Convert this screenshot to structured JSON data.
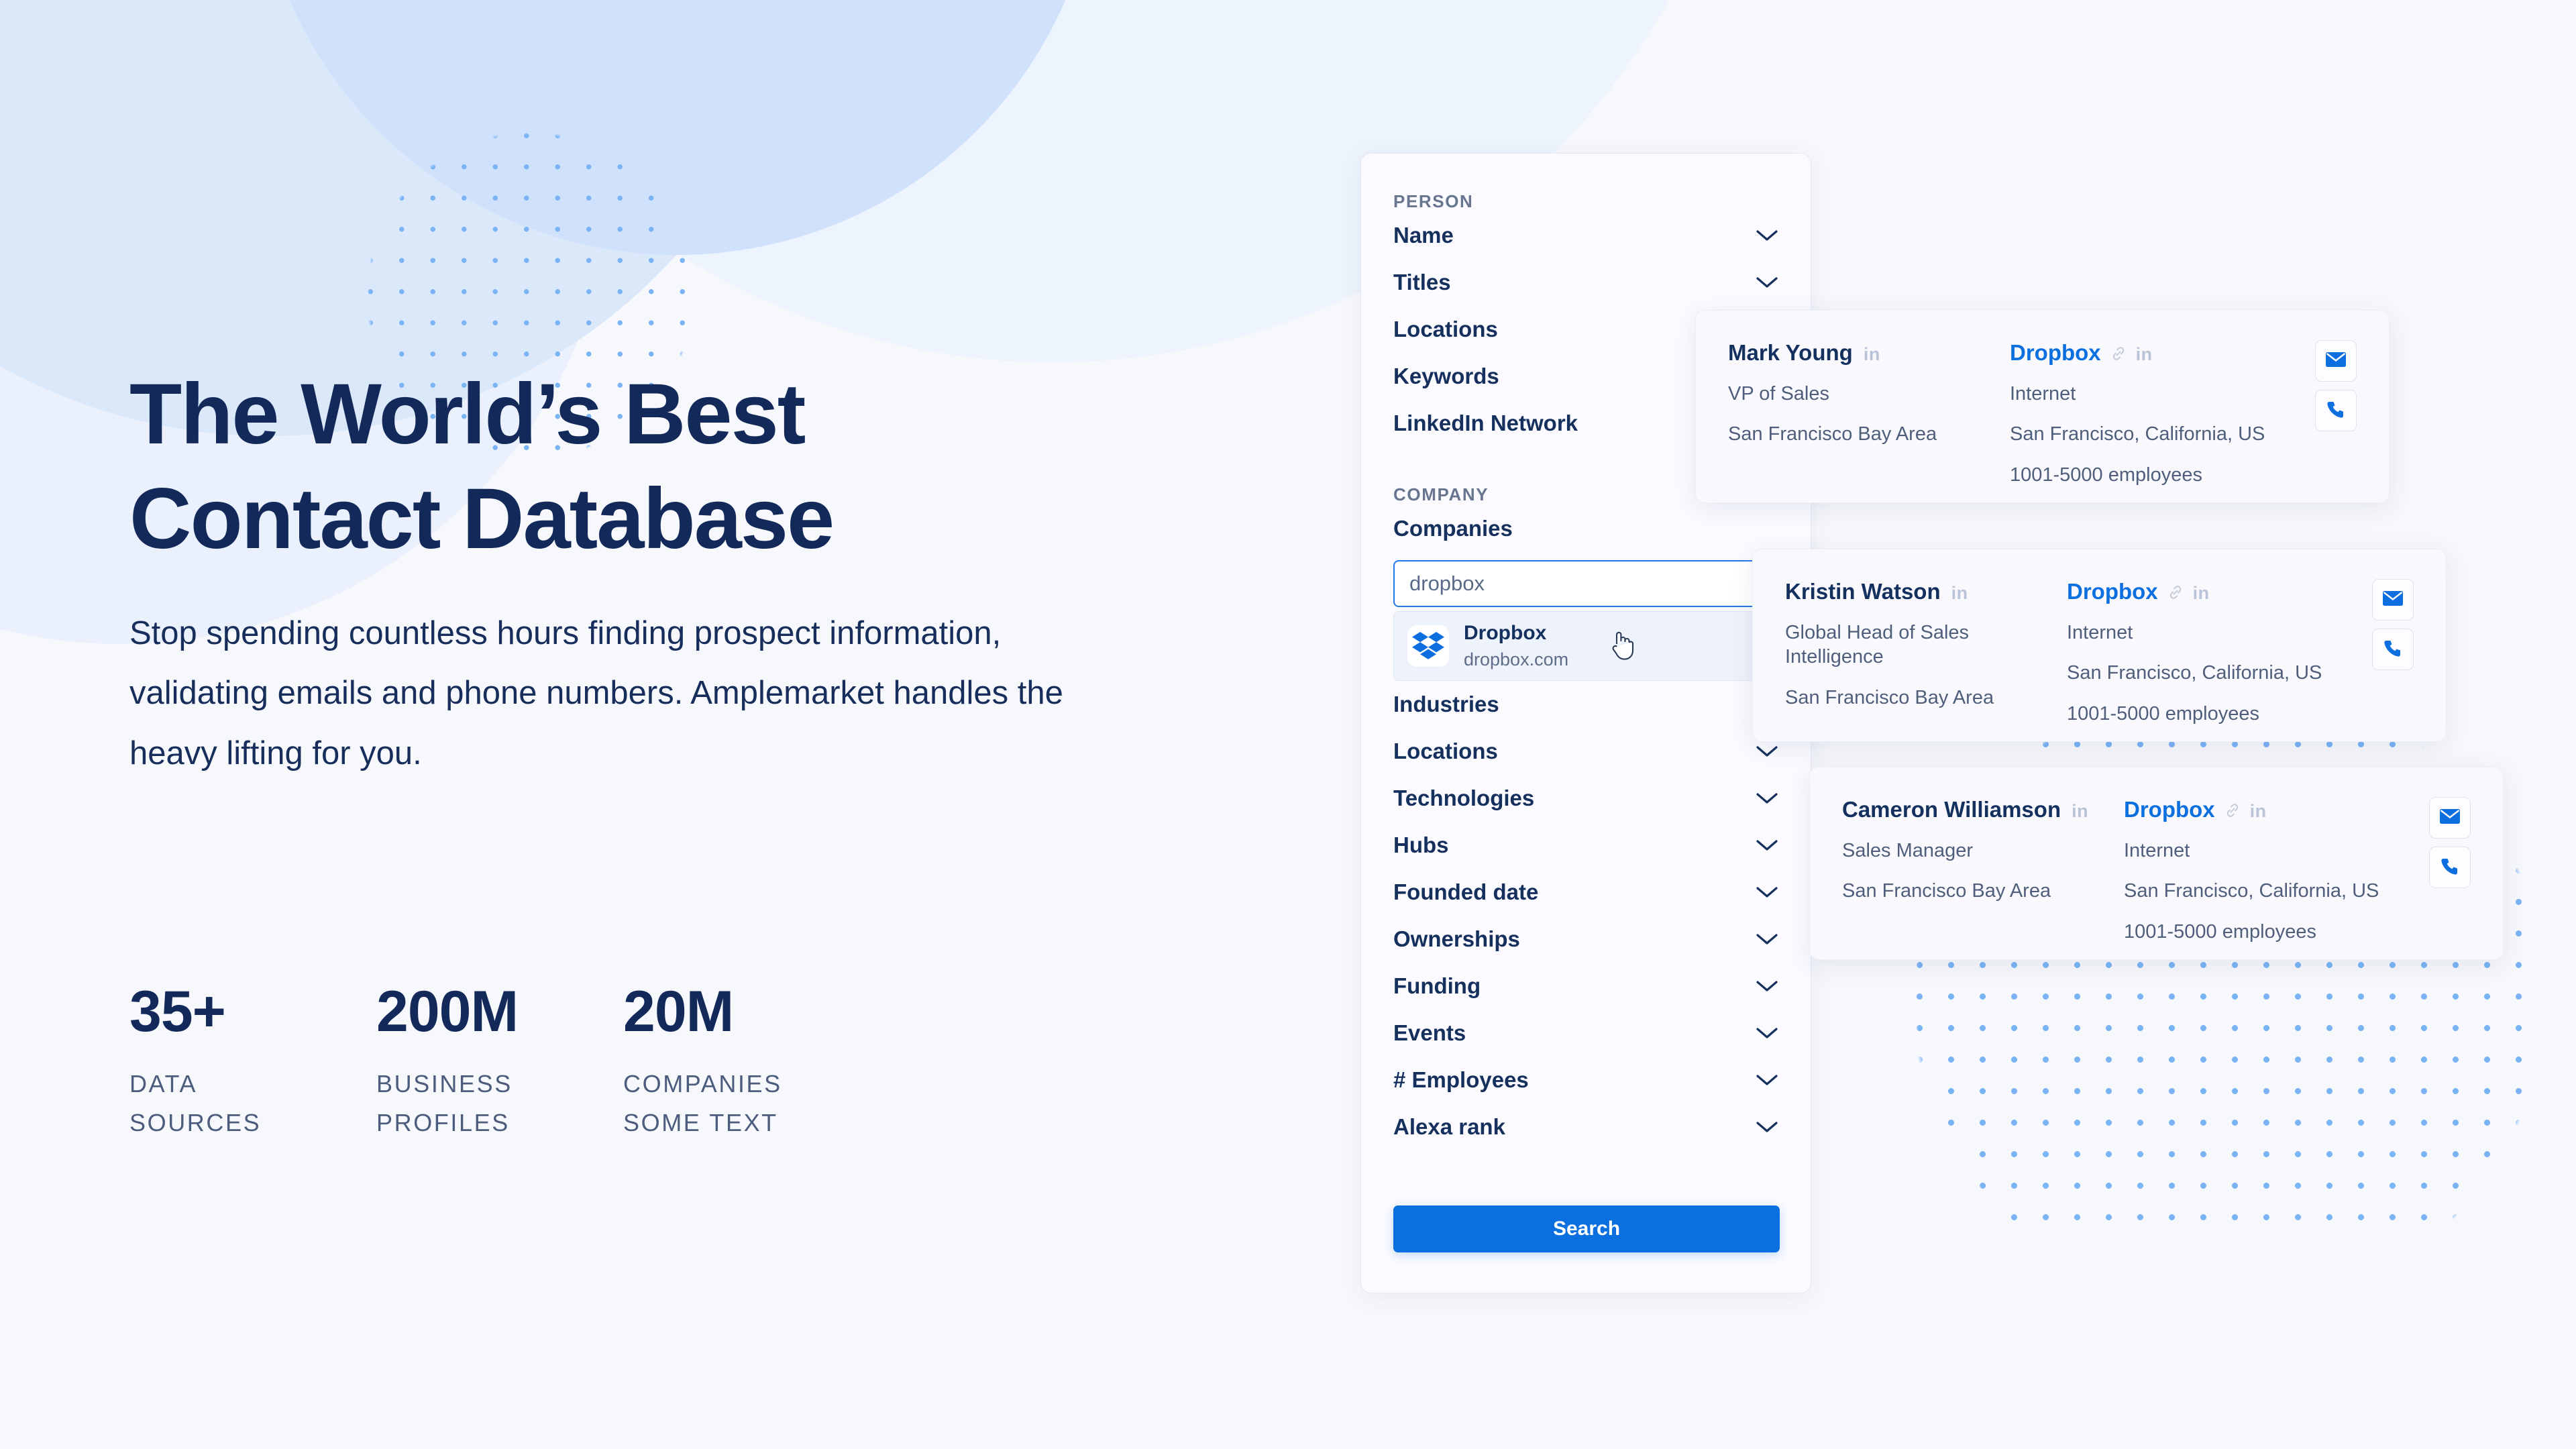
{
  "hero": {
    "heading_line1": "The World’s Best",
    "heading_line2": "Contact Database",
    "lead": "Stop spending countless hours finding prospect information, validating emails and phone numbers. Amplemarket handles the heavy lifting for you.",
    "stats": [
      {
        "value": "35+",
        "caption_line1": "DATA",
        "caption_line2": "SOURCES"
      },
      {
        "value": "200M",
        "caption_line1": "BUSINESS",
        "caption_line2": "PROFILES"
      },
      {
        "value": "20M",
        "caption_line1": "COMPANIES",
        "caption_line2": "SOME TEXT"
      }
    ]
  },
  "panel": {
    "person_label": "PERSON",
    "company_label": "COMPANY",
    "person_filters": [
      {
        "label": "Name",
        "chevron": true
      },
      {
        "label": "Titles",
        "chevron": true
      },
      {
        "label": "Locations",
        "chevron": false
      },
      {
        "label": "Keywords",
        "chevron": false
      },
      {
        "label": "LinkedIn Network",
        "chevron": false
      }
    ],
    "companies_label": "Companies",
    "search": {
      "value": "dropbox",
      "placeholder": "dropbox",
      "suggestion": {
        "name": "Dropbox",
        "url": "dropbox.com",
        "logo_icon": "dropbox-logo-icon",
        "cursor_icon": "pointer-hand-cursor"
      }
    },
    "company_filters": [
      {
        "label": "Industries",
        "chevron": true
      },
      {
        "label": "Locations",
        "chevron": true
      },
      {
        "label": "Technologies",
        "chevron": true
      },
      {
        "label": "Hubs",
        "chevron": true
      },
      {
        "label": "Founded date",
        "chevron": true
      },
      {
        "label": "Ownerships",
        "chevron": true
      },
      {
        "label": "Funding",
        "chevron": true
      },
      {
        "label": "Events",
        "chevron": true
      },
      {
        "label": "# Employees",
        "chevron": true
      },
      {
        "label": "Alexa rank",
        "chevron": true
      }
    ],
    "search_button": "Search"
  },
  "cards": [
    {
      "person_name": "Mark Young",
      "person_linkedin": "in",
      "title": "VP of Sales",
      "person_location": "San Francisco Bay Area",
      "company_name": "Dropbox",
      "company_link_icon": "chain-link-icon",
      "company_linkedin": "in",
      "industry": "Internet",
      "company_location": "San Francisco, California, US",
      "employees": "1001-5000 employees",
      "email_icon": "envelope-icon",
      "phone_icon": "phone-icon"
    },
    {
      "person_name": "Kristin Watson",
      "person_linkedin": "in",
      "title": "Global Head of Sales Intelligence",
      "person_location": "San Francisco Bay Area",
      "company_name": "Dropbox",
      "company_link_icon": "chain-link-icon",
      "company_linkedin": "in",
      "industry": "Internet",
      "company_location": "San Francisco, California, US",
      "employees": "1001-5000 employees",
      "email_icon": "envelope-icon",
      "phone_icon": "phone-icon"
    },
    {
      "person_name": "Cameron Williamson",
      "person_linkedin": "in",
      "title": "Sales Manager",
      "person_location": "San Francisco Bay Area",
      "company_name": "Dropbox",
      "company_link_icon": "chain-link-icon",
      "company_linkedin": "in",
      "industry": "Internet",
      "company_location": "San Francisco, California, US",
      "employees": "1001-5000 employees",
      "email_icon": "envelope-icon",
      "phone_icon": "phone-icon"
    }
  ],
  "colors": {
    "brand_blue": "#0b6fe0",
    "heading_navy": "#12295a",
    "dot_blue": "#7bb4f5",
    "page_bg": "#f7f8fc",
    "card_bg": "#f9f9fd"
  }
}
